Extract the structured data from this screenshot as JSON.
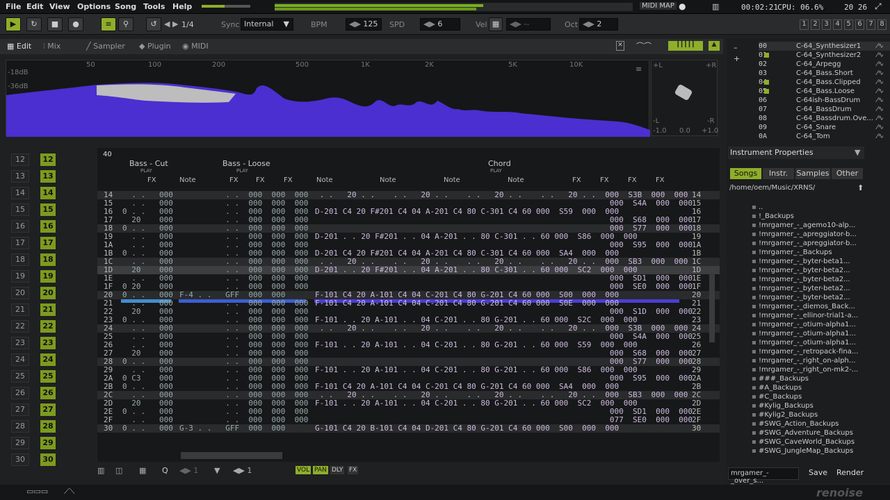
{
  "menu": [
    "File",
    "Edit",
    "View",
    "Options",
    "Song",
    "Tools",
    "Help"
  ],
  "status": {
    "midi_map": "MIDI MAP",
    "time": "00:02:21",
    "cpu": "CPU: 06.6%",
    "counts": "20  26"
  },
  "transport": {
    "pattern_pos": "1/4",
    "sync_label": "Sync",
    "sync_value": "Internal",
    "bpm_label": "BPM",
    "bpm_value": "125",
    "spd_label": "SPD",
    "spd_value": "6",
    "vel_label": "Vel",
    "vel_value": "--",
    "oct_label": "Oct",
    "oct_value": "2",
    "track_numbers": [
      "1",
      "2",
      "3",
      "4",
      "5",
      "6",
      "7",
      "8"
    ]
  },
  "view_tabs": [
    "Edit",
    "Mix",
    "Sampler",
    "Plugin",
    "MIDI"
  ],
  "spectrum": {
    "freq_labels": [
      "50",
      "100",
      "200",
      "500",
      "1K",
      "2K",
      "5K",
      "10K"
    ],
    "db_labels": [
      "-18dB",
      "-36dB"
    ],
    "stereo_labels": [
      "+L",
      "+R",
      "-L",
      "-R",
      "-1.0",
      "0.0",
      "+1.0"
    ]
  },
  "tracks": [
    {
      "name": "Bass - Cut",
      "color": "#3f8fd0",
      "sub": "PLAY",
      "cols": [
        "FX"
      ]
    },
    {
      "name": "Bass - Loose",
      "color": "#3a5ed3",
      "sub": "PLAY",
      "cols": [
        "Note",
        "FX",
        "FX",
        "FX"
      ]
    },
    {
      "name": "Chord",
      "color": "#4a3dd6",
      "sub": "PLAY",
      "cols": [
        "Note",
        "Note",
        "Note",
        "Note",
        "FX",
        "FX",
        "FX",
        "FX"
      ]
    }
  ],
  "pattern_header": "40",
  "pattern_rows": [
    {
      "n": "14",
      "a": "  . .   000",
      "b": "          . .  000  000  000",
      "c": " . .   20 . .    . .   20 . .    . .   20 . .    . .   20 . .  000  S3B  000  000"
    },
    {
      "n": "15",
      "a": "  . .   000",
      "b": "          . .  000  000  000",
      "c": "                                                                000  S4A  000  000"
    },
    {
      "n": "16",
      "a": "0 . .   000",
      "b": "          . .  000  000  000",
      "c": "D-201 C4 20 F#201 C4 04 A-201 C4 80 C-301 C4 60 000  S59  000  000"
    },
    {
      "n": "17",
      "a": "  20    000",
      "b": "          . .  000  000  000",
      "c": "                                                                000  S68  000  000"
    },
    {
      "n": "18",
      "a": "0 . .   000",
      "b": "          . .  000  000  000",
      "c": "                                                                000  S77  000  000"
    },
    {
      "n": "19",
      "a": "  . .   000",
      "b": "          . .  000  000  000",
      "c": "D-201 . . 20 F#201 . . 04 A-201 . . 80 C-301 . . 60 000  S86  000  000"
    },
    {
      "n": "1A",
      "a": "  . .   000",
      "b": "          . .  000  000  000",
      "c": "                                                                000  S95  000  000"
    },
    {
      "n": "1B",
      "a": "0 . .   000",
      "b": "          . .  000  000  000",
      "c": "D-201 C4 20 F#201 C4 04 A-201 C4 80 C-301 C4 60 000  SA4  000  000"
    },
    {
      "n": "1C",
      "a": "  . .   000",
      "b": "          . .  000  000  000",
      "c": " . .   20 . .    . .   20 . .    . .   20 . .    . .   20 . .  000  SB3  000  000"
    },
    {
      "n": "1D",
      "a": "  20    000",
      "b": "          . .  000  000  000",
      "c": "D-201 . . 20 F#201 . . 04 A-201 . . 80 C-301 . . 60 000  SC2  000  000"
    },
    {
      "n": "1E",
      "a": "  . .   000",
      "b": "          . .  000  000  000",
      "c": "                                                                000  SD1  000  000"
    },
    {
      "n": "1F",
      "a": "0 20    000",
      "b": "          . .  000  000  000",
      "c": "                                                                000  SE0  000  000"
    },
    {
      "n": "20",
      "a": "0 . .   000",
      "b": "F-4 . .   GFF  000  000",
      "c": "F-101 C4 20 A-101 C4 04 C-201 C4 80 G-201 C4 60 000  S00  000  000"
    },
    {
      "n": "21",
      "a": "  . .   000",
      "b": "          . .  000  000  000",
      "c": "F-101 C4 20 A-101 C4 04 C-201 C4 80 G-201 C4 60 000  S0E  000  000"
    },
    {
      "n": "22",
      "a": "  20    000",
      "b": "          . .  000  000  000",
      "c": "                                                                000  S1D  000  000"
    },
    {
      "n": "23",
      "a": "0 . .   000",
      "b": "          . .  000  000  000",
      "c": "F-101 . . 20 A-101 . . 04 C-201 . . 80 G-201 . . 60 000  S2C  000  000"
    },
    {
      "n": "24",
      "a": "  . .   000",
      "b": "          . .  000  000  000",
      "c": " . .   20 . .    . .   20 . .    . .   20 . .    . .   20 . .  000  S3B  000  000"
    },
    {
      "n": "25",
      "a": "  . .   000",
      "b": "          . .  000  000  000",
      "c": "                                                                000  S4A  000  000"
    },
    {
      "n": "26",
      "a": "  . .   000",
      "b": "          . .  000  000  000",
      "c": "F-101 . . 20 A-101 . . 04 C-201 . . 80 G-201 . . 60 000  S59  000  000"
    },
    {
      "n": "27",
      "a": "  20    000",
      "b": "          . .  000  000  000",
      "c": "                                                                000  S68  000  000"
    },
    {
      "n": "28",
      "a": "0 . .   000",
      "b": "          . .  000  000  000",
      "c": "                                                                000  S77  000  000"
    },
    {
      "n": "29",
      "a": "  . .   000",
      "b": "          . .  000  000  000",
      "c": "F-101 . . 20 A-101 . . 04 C-201 . . 80 G-201 . . 60 000  S86  000  000"
    },
    {
      "n": "2A",
      "a": "0 C3    000",
      "b": "          . .  000  000  000",
      "c": "                                                                000  S95  000  000"
    },
    {
      "n": "2B",
      "a": "0 . .   000",
      "b": "          . .  000  000  000",
      "c": "F-101 C4 20 A-101 C4 04 C-201 C4 80 G-201 C4 60 000  SA4  000  000"
    },
    {
      "n": "2C",
      "a": "  . .   000",
      "b": "          . .  000  000  000",
      "c": " . .   20 . .    . .   20 . .    . .   20 . .    . .   20 . .  000  SB3  000  000"
    },
    {
      "n": "2D",
      "a": "  20    000",
      "b": "          . .  000  000  000",
      "c": "F-101 . . 20 A-101 . . 04 C-201 . . 80 G-201 . . 60 000  SC2  000  000"
    },
    {
      "n": "2E",
      "a": "0 . .   000",
      "b": "          . .  000  000  000",
      "c": "                                                                000  SD1  000  000"
    },
    {
      "n": "2F",
      "a": "  . .   000",
      "b": "          . .  000  000  000",
      "c": "                                                                077  SE0  000  000"
    },
    {
      "n": "30",
      "a": "0 . .   000",
      "b": "G-3 . .   GFF  000  000",
      "c": "G-101 C4 20 B-101 C4 04 D-201 C4 80 G-201 C4 60 000  S00  000  000"
    }
  ],
  "sequencer": [
    "12",
    "13",
    "14",
    "15",
    "16",
    "17",
    "18",
    "19",
    "20",
    "21",
    "22",
    "23",
    "24",
    "25",
    "26",
    "27",
    "28",
    "29",
    "30"
  ],
  "instruments": [
    {
      "idx": "00",
      "name": "C-64_Synthesizer1"
    },
    {
      "idx": "01",
      "name": "C-64_Synthesizer2"
    },
    {
      "idx": "02",
      "name": "C-64_Arpegg"
    },
    {
      "idx": "03",
      "name": "C-64_Bass.Short"
    },
    {
      "idx": "04",
      "name": "C-64_Bass.Clipped"
    },
    {
      "idx": "05",
      "name": "C-64_Bass.Loose"
    },
    {
      "idx": "06",
      "name": "C-64ish-BassDrum"
    },
    {
      "idx": "07",
      "name": "C-64_BassDrum"
    },
    {
      "idx": "08",
      "name": "C-64_Bassdrum.Ove..."
    },
    {
      "idx": "09",
      "name": "C-64_Snare"
    },
    {
      "idx": "0A",
      "name": "C-64_Tom"
    }
  ],
  "instrument_properties": "Instrument Properties",
  "browser_tabs": [
    "Songs",
    "Instr.",
    "Samples",
    "Other"
  ],
  "browser_path": "/home/oem/Music/XRNS/",
  "files": [
    "..",
    "!_Backups",
    "!mrgamer_-_agemo10-alp...",
    "!mrgamer_-_apreggiator-b...",
    "!mrgamer_-_apreggiator-b...",
    "!mrgamer_-_Backups",
    "!mrgamer_-_byter-beta1...",
    "!mrgamer_-_byter-beta2...",
    "!mrgamer_-_byter-beta2...",
    "!mrgamer_-_byter-beta2...",
    "!mrgamer_-_byter-beta2...",
    "!mrgamer_-_diemos_Back...",
    "!mrgamer_-_ellinor-trial1-a...",
    "!mrgamer_-_otium-alpha1...",
    "!mrgamer_-_otium-alpha1...",
    "!mrgamer_-_otium-alpha1...",
    "!mrgamer_-_retropack-fina...",
    "!mrgamer_-_right_on-alph...",
    "!mrgamer_-_right_on-mk2-...",
    "###_Backups",
    "#A_Backups",
    "#C_Backups",
    "#Kylig_Backups",
    "#Kylig2_Backups",
    "#SWG_Action_Backups",
    "#SWG_Adventure_Backups",
    "#SWG_CaveWorld_Backups",
    "#SWG_JungleMap_Backups"
  ],
  "save_name": "mrgamer_-_over_s...",
  "save_label": "Save",
  "render_label": "Render",
  "bottom_bar": {
    "lines": "1",
    "step": "1",
    "vol": "VOL",
    "pan": "PAN",
    "dly": "DLY",
    "fx": "FX"
  },
  "logo": "renoise"
}
